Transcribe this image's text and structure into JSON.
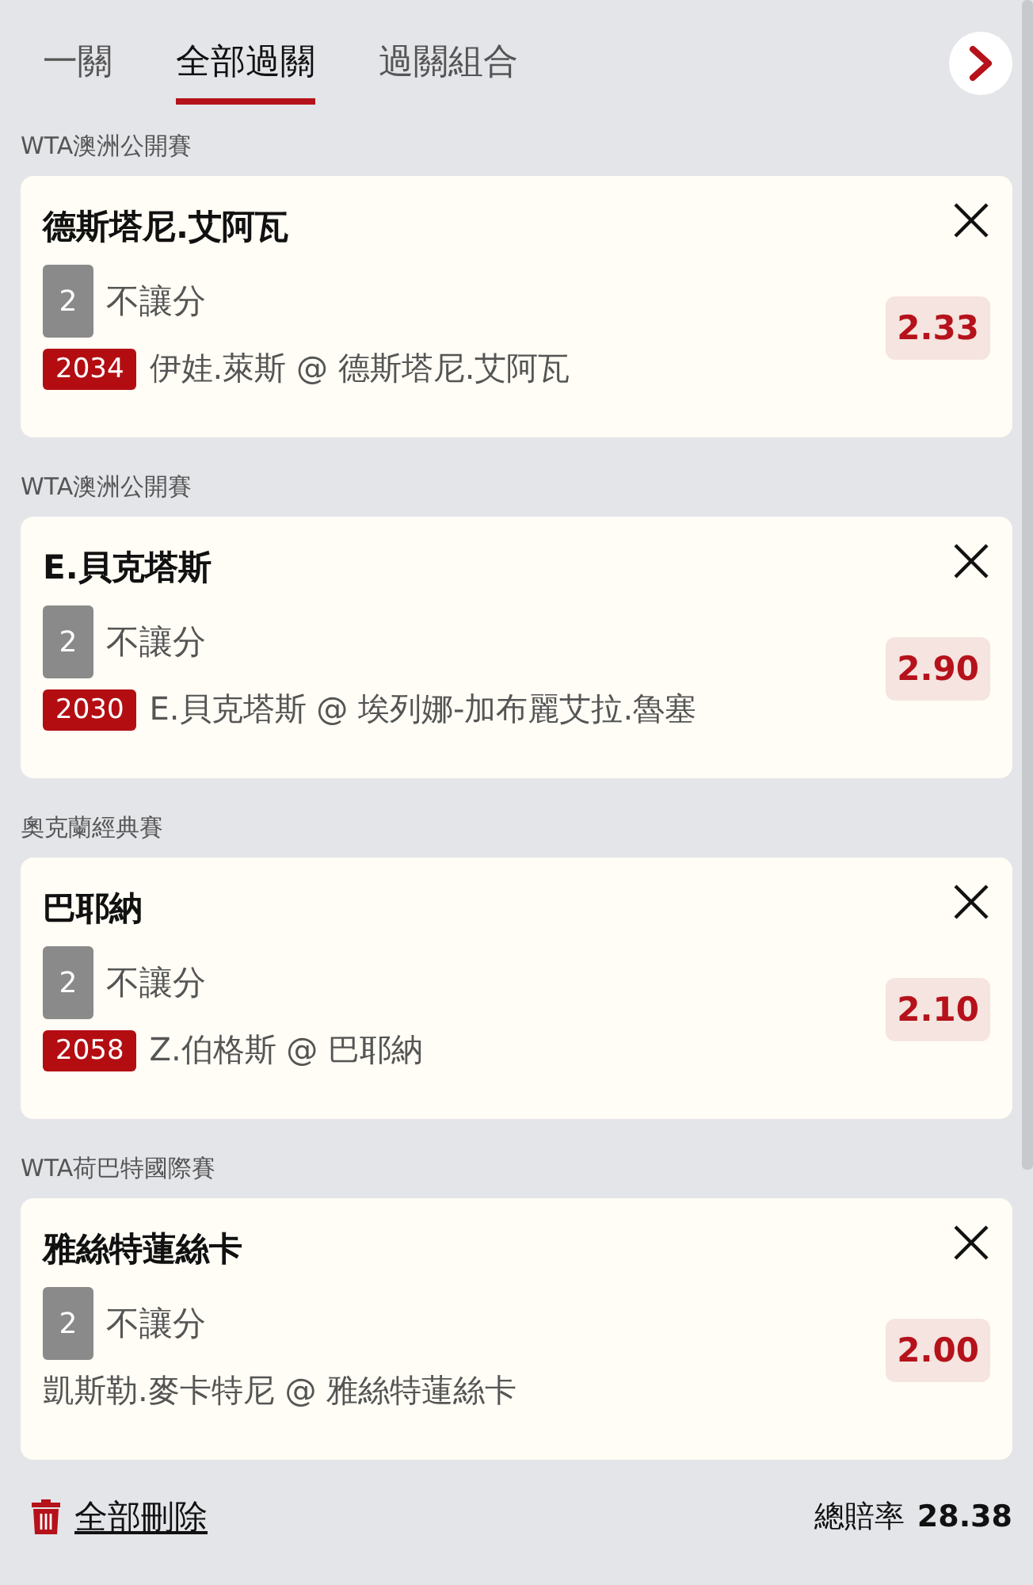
{
  "tabs": [
    {
      "label": "一關",
      "selected": false
    },
    {
      "label": "全部過關",
      "selected": true
    },
    {
      "label": "過關組合",
      "selected": false
    }
  ],
  "bets": [
    {
      "league": "WTA澳洲公開賽",
      "title": "德斯塔尼.艾阿瓦",
      "leg": "2",
      "market": "不讓分",
      "code": "2034",
      "match": "伊娃.萊斯 @ 德斯塔尼.艾阿瓦",
      "odds": "2.33"
    },
    {
      "league": "WTA澳洲公開賽",
      "title": "E.貝克塔斯",
      "leg": "2",
      "market": "不讓分",
      "code": "2030",
      "match": "E.貝克塔斯 @ 埃列娜-加布麗艾拉.魯塞",
      "odds": "2.90"
    },
    {
      "league": "奧克蘭經典賽",
      "title": "巴耶納",
      "leg": "2",
      "market": "不讓分",
      "code": "2058",
      "match": "Z.伯格斯 @ 巴耶納",
      "odds": "2.10"
    },
    {
      "league": "WTA荷巴特國際賽",
      "title": "雅絲特蓮絲卡",
      "leg": "2",
      "market": "不讓分",
      "match": "凱斯勒.麥卡特尼 @ 雅絲特蓮絲卡",
      "odds": "2.00"
    }
  ],
  "footer": {
    "delete_all": "全部刪除",
    "total_label": "總賠率",
    "total": "28.38"
  }
}
